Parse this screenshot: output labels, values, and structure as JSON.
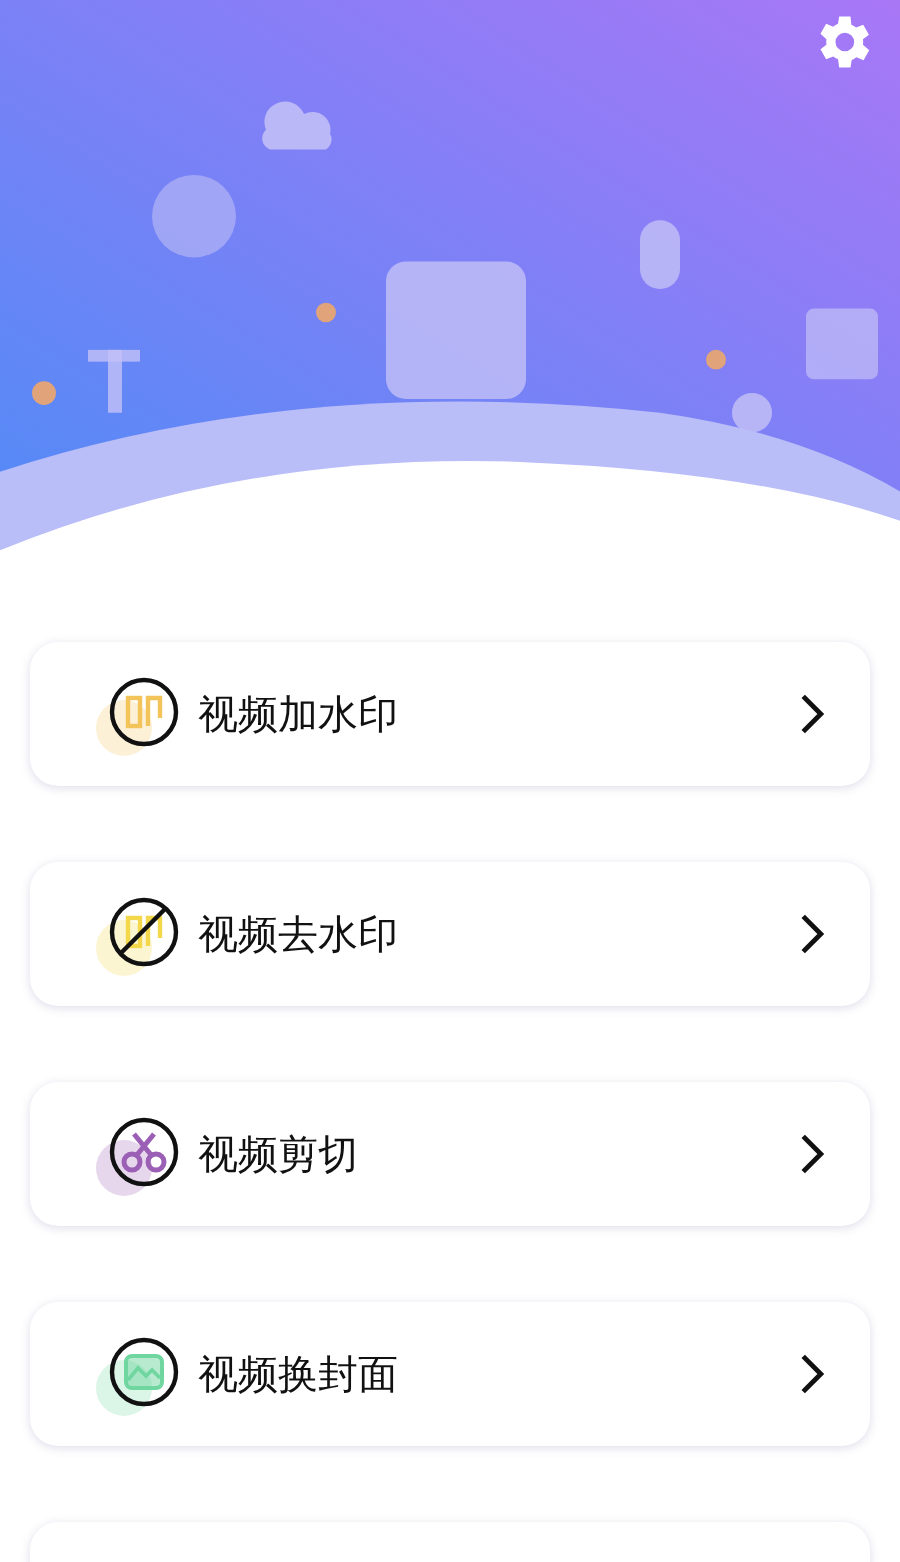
{
  "items": [
    {
      "label": "视频加水印",
      "kind": "add-watermark",
      "color": "#f2c45a"
    },
    {
      "label": "视频去水印",
      "kind": "remove-watermark",
      "color": "#f2d84a"
    },
    {
      "label": "视频剪切",
      "kind": "cut",
      "color": "#9b5fb5"
    },
    {
      "label": "视频换封面",
      "kind": "cover",
      "color": "#6fd6a0"
    }
  ]
}
